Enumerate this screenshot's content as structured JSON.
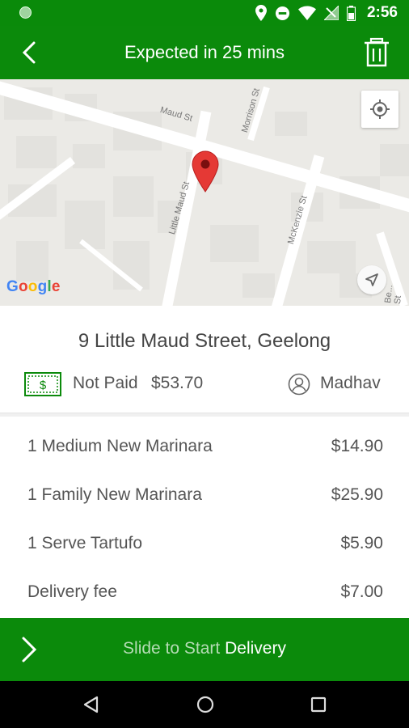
{
  "status_bar": {
    "time": "2:56",
    "icons": [
      "location-icon",
      "do-not-disturb-icon",
      "wifi-icon",
      "signal-icon",
      "battery-icon"
    ]
  },
  "app_bar": {
    "title": "Expected in 25 mins",
    "color": "#0b8a0b"
  },
  "map": {
    "streets": {
      "maud": "Maud St",
      "morrison": "Morrison St",
      "little_maud": "Little Maud St",
      "mckenzie": "McKenzie St",
      "bellerine": "Be... St"
    },
    "logo": [
      "G",
      "o",
      "o",
      "g",
      "l",
      "e"
    ],
    "pin_color": "#e53935"
  },
  "order": {
    "address": "9 Little Maud Street, Geelong",
    "payment_status": "Not Paid",
    "amount": "$53.70",
    "driver": "Madhav",
    "items": [
      {
        "name": "1 Medium New Marinara",
        "price": "$14.90"
      },
      {
        "name": "1 Family New Marinara",
        "price": "$25.90"
      },
      {
        "name": "1 Serve Tartufo",
        "price": "$5.90"
      },
      {
        "name": "Delivery fee",
        "price": "$7.00"
      }
    ]
  },
  "slide": {
    "prefix": "Slide to Start ",
    "highlight": "Delivery"
  }
}
